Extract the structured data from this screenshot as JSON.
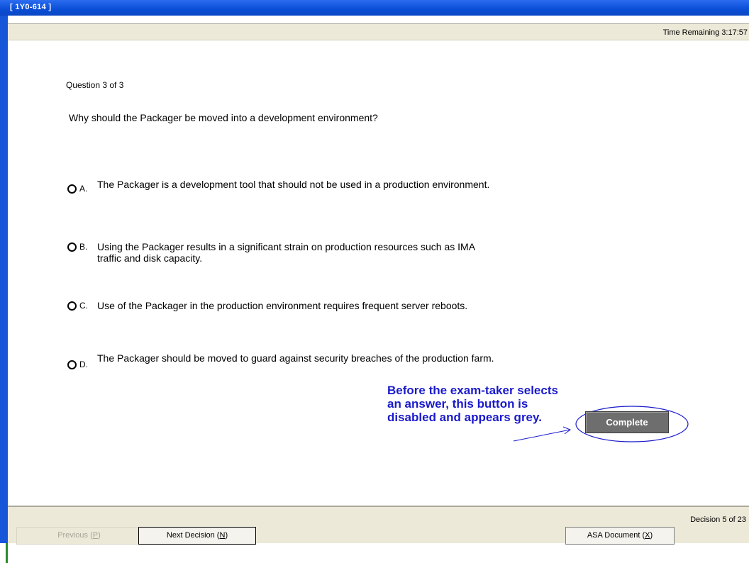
{
  "window": {
    "title": "[ 1Y0-614 ]"
  },
  "status": {
    "time_remaining": "Time Remaining 3:17:57"
  },
  "question": {
    "number": "Question 3 of 3",
    "text": "Why should the Packager be moved into a development environment?",
    "options": [
      {
        "letter": "A.",
        "text": "The Packager is a development tool that should not be used in a production environment."
      },
      {
        "letter": "B.",
        "text": "Using the Packager results in a significant strain on production resources such as IMA traffic and disk capacity."
      },
      {
        "letter": "C.",
        "text": "Use of the Packager in the production environment requires frequent server reboots."
      },
      {
        "letter": "D.",
        "text": "The Packager should be moved to guard against security breaches of the production farm."
      }
    ]
  },
  "annotation": {
    "text": "Before the exam-taker selects an answer, this button is disabled and appears grey.",
    "color": "#1a1acc"
  },
  "complete_button": {
    "label": "Complete",
    "state": "disabled"
  },
  "footer": {
    "decision": "Decision 5 of 23",
    "previous_label": "Previous",
    "previous_key": "P",
    "next_label": "Next Decision",
    "next_key": "N",
    "asa_label": "ASA Document",
    "asa_key": "X"
  },
  "colors": {
    "titlebar": "#0a4ed6",
    "panel": "#ece9d8"
  }
}
